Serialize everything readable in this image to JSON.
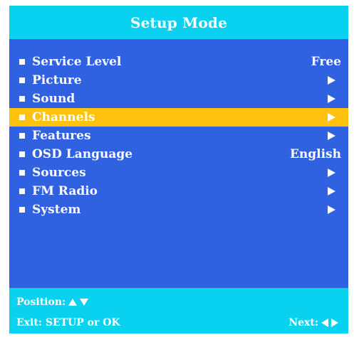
{
  "title": "Setup Mode",
  "colors": {
    "panel": "#2f61e0",
    "header": "#08d2f0",
    "selected": "#ffc20e",
    "text": "#ffffff"
  },
  "menu": {
    "items": [
      {
        "label": "Service Level",
        "value": "Free",
        "icon": null,
        "selected": false
      },
      {
        "label": "Picture",
        "value": null,
        "icon": "arrow-right-icon",
        "selected": false
      },
      {
        "label": "Sound",
        "value": null,
        "icon": "arrow-right-icon",
        "selected": false
      },
      {
        "label": "Channels",
        "value": null,
        "icon": "arrow-right-icon",
        "selected": true
      },
      {
        "label": "Features",
        "value": null,
        "icon": "arrow-right-icon",
        "selected": false
      },
      {
        "label": "OSD Language",
        "value": "English",
        "icon": null,
        "selected": false
      },
      {
        "label": "Sources",
        "value": null,
        "icon": "arrow-right-icon",
        "selected": false
      },
      {
        "label": "FM Radio",
        "value": null,
        "icon": "arrow-right-icon",
        "selected": false
      },
      {
        "label": "System",
        "value": null,
        "icon": "arrow-right-icon",
        "selected": false
      }
    ]
  },
  "footer": {
    "position_label": "Position:",
    "exit_label": "Exit: SETUP or OK",
    "next_label": "Next:"
  }
}
